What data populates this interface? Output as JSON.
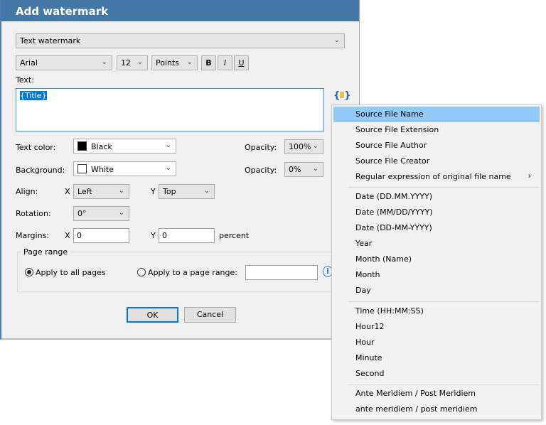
{
  "dialog": {
    "title": "Add watermark",
    "type": "Text watermark",
    "font": "Arial",
    "size": "12",
    "unit": "Points",
    "bold": "B",
    "italic": "I",
    "underline": "U",
    "text_label": "Text:",
    "text_value": "{Title}",
    "text_color_label": "Text color:",
    "text_color": "Black",
    "opacity_label": "Opacity:",
    "text_opacity": "100%",
    "background_label": "Background:",
    "background": "White",
    "bg_opacity": "0%",
    "align_label": "Align:",
    "x": "X",
    "y": "Y",
    "align_x": "Left",
    "align_y": "Top",
    "rotation_label": "Rotation:",
    "rotation": "0°",
    "margins_label": "Margins:",
    "margin_x": "0",
    "margin_y": "0",
    "percent": "percent",
    "page_range_label": "Page range",
    "apply_all": "Apply to all pages",
    "apply_range": "Apply to a page range:",
    "range_value": "",
    "ok": "OK",
    "cancel": "Cancel"
  },
  "menu": {
    "items": [
      "Source File Name",
      "Source File Extension",
      "Source File Author",
      "Source File Creator",
      "Regular expression of original file name",
      "Date (DD.MM.YYYY)",
      "Date (MM/DD/YYYY)",
      "Date (DD-MM-YYYY)",
      "Year",
      "Month (Name)",
      "Month",
      "Day",
      "Time (HH:MM:SS)",
      "Hour12",
      "Hour",
      "Minute",
      "Second",
      "Ante Meridiem / Post Meridiem",
      "ante meridiem / post meridiem"
    ],
    "submenu_arrow": "›"
  },
  "colors": {
    "title_bar": "#4277a6",
    "highlight": "#91c9f7"
  }
}
